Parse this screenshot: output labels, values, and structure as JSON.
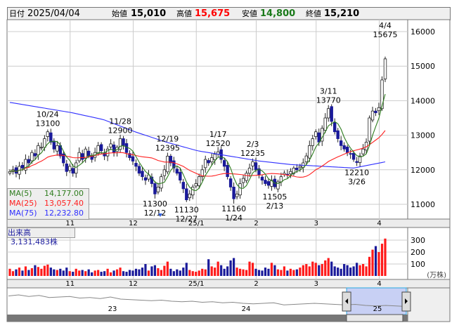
{
  "header": {
    "date_label": "日付",
    "date": "2025/04/04",
    "open_label": "始値",
    "open": "15,010",
    "high_label": "高値",
    "high": "15,675",
    "low_label": "安値",
    "low": "14,800",
    "close_label": "終値",
    "close": "15,210"
  },
  "ma_legend": [
    {
      "label": "MA(5)",
      "value": "14,177.00",
      "color": "#2e7d1e"
    },
    {
      "label": "MA(25)",
      "value": "13,057.40",
      "color": "#ff2020"
    },
    {
      "label": "MA(75)",
      "value": "12,232.80",
      "color": "#3030ff"
    }
  ],
  "volume_legend": {
    "label": "出来高",
    "value": "3,131,483株"
  },
  "volume_unit": "(万株)",
  "colors": {
    "up_fill": "#ffffff",
    "down_fill": "#1a1a9a",
    "vol_up": "#ff1a1a",
    "vol_down": "#1a1a9a",
    "grid": "#cccccc"
  },
  "chart_data": {
    "type": "candlestick",
    "price_axis": {
      "ticks": [
        "16000",
        "15000",
        "14000",
        "13000",
        "12000",
        "11000"
      ],
      "range": [
        10700,
        16300
      ]
    },
    "volume_axis": {
      "ticks": [
        "300",
        "200",
        "100"
      ],
      "range": [
        0,
        340
      ]
    },
    "month_labels": [
      {
        "label": "11",
        "index": 20
      },
      {
        "label": "12",
        "index": 40
      },
      {
        "label": "25/1",
        "index": 60
      },
      {
        "label": "2",
        "index": 79
      },
      {
        "label": "3",
        "index": 98
      },
      {
        "label": "4",
        "index": 118
      }
    ],
    "closes": [
      11950,
      12000,
      11900,
      12100,
      12050,
      12300,
      12200,
      12500,
      12400,
      12700,
      12650,
      12900,
      13100,
      12800,
      12600,
      12700,
      12400,
      12200,
      11950,
      12100,
      11900,
      12200,
      12500,
      12300,
      12600,
      12400,
      12300,
      12500,
      12700,
      12550,
      12400,
      12600,
      12750,
      12500,
      12650,
      12900,
      12700,
      12500,
      12350,
      12250,
      12100,
      11900,
      11800,
      11700,
      11850,
      11600,
      11300,
      11500,
      11800,
      12000,
      12395,
      12200,
      12050,
      11900,
      11700,
      11450,
      11130,
      11300,
      11500,
      11600,
      11800,
      12000,
      12300,
      12200,
      12350,
      12450,
      12520,
      12300,
      12100,
      11800,
      11500,
      11160,
      11300,
      11600,
      11750,
      11900,
      12050,
      12235,
      12000,
      11850,
      11700,
      11600,
      11550,
      11700,
      11505,
      11650,
      11800,
      11900,
      11850,
      11950,
      12050,
      12000,
      12100,
      12200,
      12400,
      12700,
      12900,
      13100,
      12800,
      13200,
      13500,
      13770,
      13400,
      13100,
      12900,
      12700,
      12600,
      12500,
      12450,
      12300,
      12210,
      12400,
      12600,
      12800,
      13500,
      13700,
      13650,
      13800,
      14600,
      15210
    ],
    "volumes": [
      60,
      40,
      55,
      70,
      45,
      80,
      50,
      65,
      90,
      75,
      60,
      85,
      95,
      70,
      55,
      50,
      60,
      45,
      70,
      40,
      35,
      60,
      45,
      50,
      40,
      55,
      30,
      45,
      50,
      35,
      40,
      60,
      30,
      45,
      55,
      70,
      40,
      35,
      50,
      45,
      60,
      55,
      70,
      100,
      45,
      80,
      90,
      65,
      50,
      85,
      120,
      60,
      40,
      55,
      45,
      70,
      110,
      50,
      40,
      35,
      45,
      60,
      55,
      140,
      80,
      70,
      120,
      90,
      60,
      80,
      130,
      150,
      70,
      60,
      55,
      50,
      120,
      110,
      60,
      50,
      45,
      70,
      60,
      110,
      90,
      55,
      50,
      80,
      45,
      60,
      50,
      55,
      70,
      90,
      100,
      80,
      120,
      110,
      90,
      100,
      130,
      150,
      120,
      80,
      70,
      60,
      100,
      90,
      70,
      80,
      110,
      90,
      100,
      80,
      160,
      220,
      250,
      200,
      270,
      313
    ],
    "ma75_samples": [
      13950,
      13800,
      13650,
      13450,
      13100,
      12800,
      12550,
      12400,
      12250,
      12150,
      12100,
      12050,
      12230
    ],
    "annotations": [
      {
        "date": "10/24",
        "value": "13100",
        "index": 12,
        "side": "above"
      },
      {
        "date": "11/28",
        "value": "12900",
        "index": 35,
        "side": "above"
      },
      {
        "date": "12/19",
        "value": "12395",
        "index": 50,
        "side": "above"
      },
      {
        "date": "1/17",
        "value": "12520",
        "index": 66,
        "side": "above"
      },
      {
        "date": "2/3",
        "value": "12235",
        "index": 77,
        "side": "above"
      },
      {
        "date": "3/11",
        "value": "13770",
        "index": 101,
        "side": "above"
      },
      {
        "date": "4/4",
        "value": "15675",
        "index": 119,
        "side": "above"
      },
      {
        "date": "12/12",
        "value": "11300",
        "index": 46,
        "side": "below"
      },
      {
        "date": "12/27",
        "value": "11130",
        "index": 56,
        "side": "below"
      },
      {
        "date": "1/24",
        "value": "11160",
        "index": 71,
        "side": "below"
      },
      {
        "date": "2/13",
        "value": "11505",
        "index": 84,
        "side": "below"
      },
      {
        "date": "3/26",
        "value": "12210",
        "index": 110,
        "side": "below"
      }
    ],
    "overview": {
      "year_labels": [
        "23",
        "24",
        "25"
      ],
      "line": [
        30,
        28,
        31,
        29,
        33,
        32,
        31,
        34,
        33,
        35,
        32,
        36,
        37,
        38,
        39,
        38,
        40,
        41,
        40,
        42,
        41,
        43,
        42,
        44,
        45,
        44,
        43,
        47,
        46,
        45,
        44,
        45,
        46,
        47,
        46,
        48,
        49,
        48,
        49,
        50
      ],
      "selected_range": [
        0.85,
        1.0
      ]
    }
  }
}
